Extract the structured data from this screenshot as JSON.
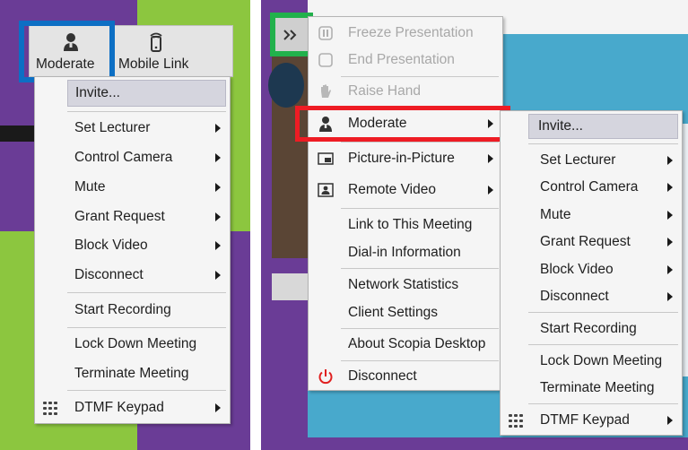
{
  "colors": {
    "purple": "#6a3c96",
    "green": "#8cc63f",
    "teal": "#48a9cc",
    "highlight_blue": "#0d6fc4",
    "highlight_red": "#ee1c24",
    "highlight_green": "#22b14c"
  },
  "left": {
    "toolbar": {
      "moderate_label": "Moderate",
      "mobile_link_label": "Mobile Link",
      "moderate_icon": "person-icon",
      "mobile_link_icon": "phone-signal-icon"
    },
    "menu": {
      "items": [
        {
          "label": "Invite...",
          "submenu": false
        },
        {
          "label": "Set Lecturer",
          "submenu": true
        },
        {
          "label": "Control Camera",
          "submenu": true
        },
        {
          "label": "Mute",
          "submenu": true
        },
        {
          "label": "Grant Request",
          "submenu": true
        },
        {
          "label": "Block Video",
          "submenu": true
        },
        {
          "label": "Disconnect",
          "submenu": true
        },
        {
          "label": "Start Recording",
          "submenu": false
        },
        {
          "label": "Lock Down Meeting",
          "submenu": false
        },
        {
          "label": "Terminate Meeting",
          "submenu": false
        },
        {
          "label": "DTMF Keypad",
          "submenu": true,
          "icon": "keypad-icon"
        }
      ]
    }
  },
  "right": {
    "expand_icon": "double-chevron-icon",
    "main_menu": {
      "items": [
        {
          "label": "Freeze Presentation",
          "disabled": true,
          "icon": "pause-icon"
        },
        {
          "label": "End Presentation",
          "disabled": true,
          "icon": "stop-icon"
        },
        {
          "label": "Raise Hand",
          "disabled": true,
          "icon": "hand-icon"
        },
        {
          "label": "Moderate",
          "submenu": true,
          "icon": "person-icon"
        },
        {
          "label": "Picture-in-Picture",
          "submenu": true,
          "icon": "pip-icon"
        },
        {
          "label": "Remote Video",
          "submenu": true,
          "icon": "remote-video-icon"
        },
        {
          "label": "Link to This Meeting"
        },
        {
          "label": "Dial-in Information"
        },
        {
          "label": "Network Statistics"
        },
        {
          "label": "Client Settings"
        },
        {
          "label": "About Scopia Desktop"
        },
        {
          "label": "Disconnect",
          "icon": "power-icon"
        }
      ]
    },
    "submenu": {
      "items": [
        {
          "label": "Invite...",
          "submenu": false
        },
        {
          "label": "Set Lecturer",
          "submenu": true
        },
        {
          "label": "Control Camera",
          "submenu": true
        },
        {
          "label": "Mute",
          "submenu": true
        },
        {
          "label": "Grant Request",
          "submenu": true
        },
        {
          "label": "Block Video",
          "submenu": true
        },
        {
          "label": "Disconnect",
          "submenu": true
        },
        {
          "label": "Start Recording",
          "submenu": false
        },
        {
          "label": "Lock Down Meeting",
          "submenu": false
        },
        {
          "label": "Terminate Meeting",
          "submenu": false
        },
        {
          "label": "DTMF Keypad",
          "submenu": true,
          "icon": "keypad-icon"
        }
      ]
    }
  }
}
